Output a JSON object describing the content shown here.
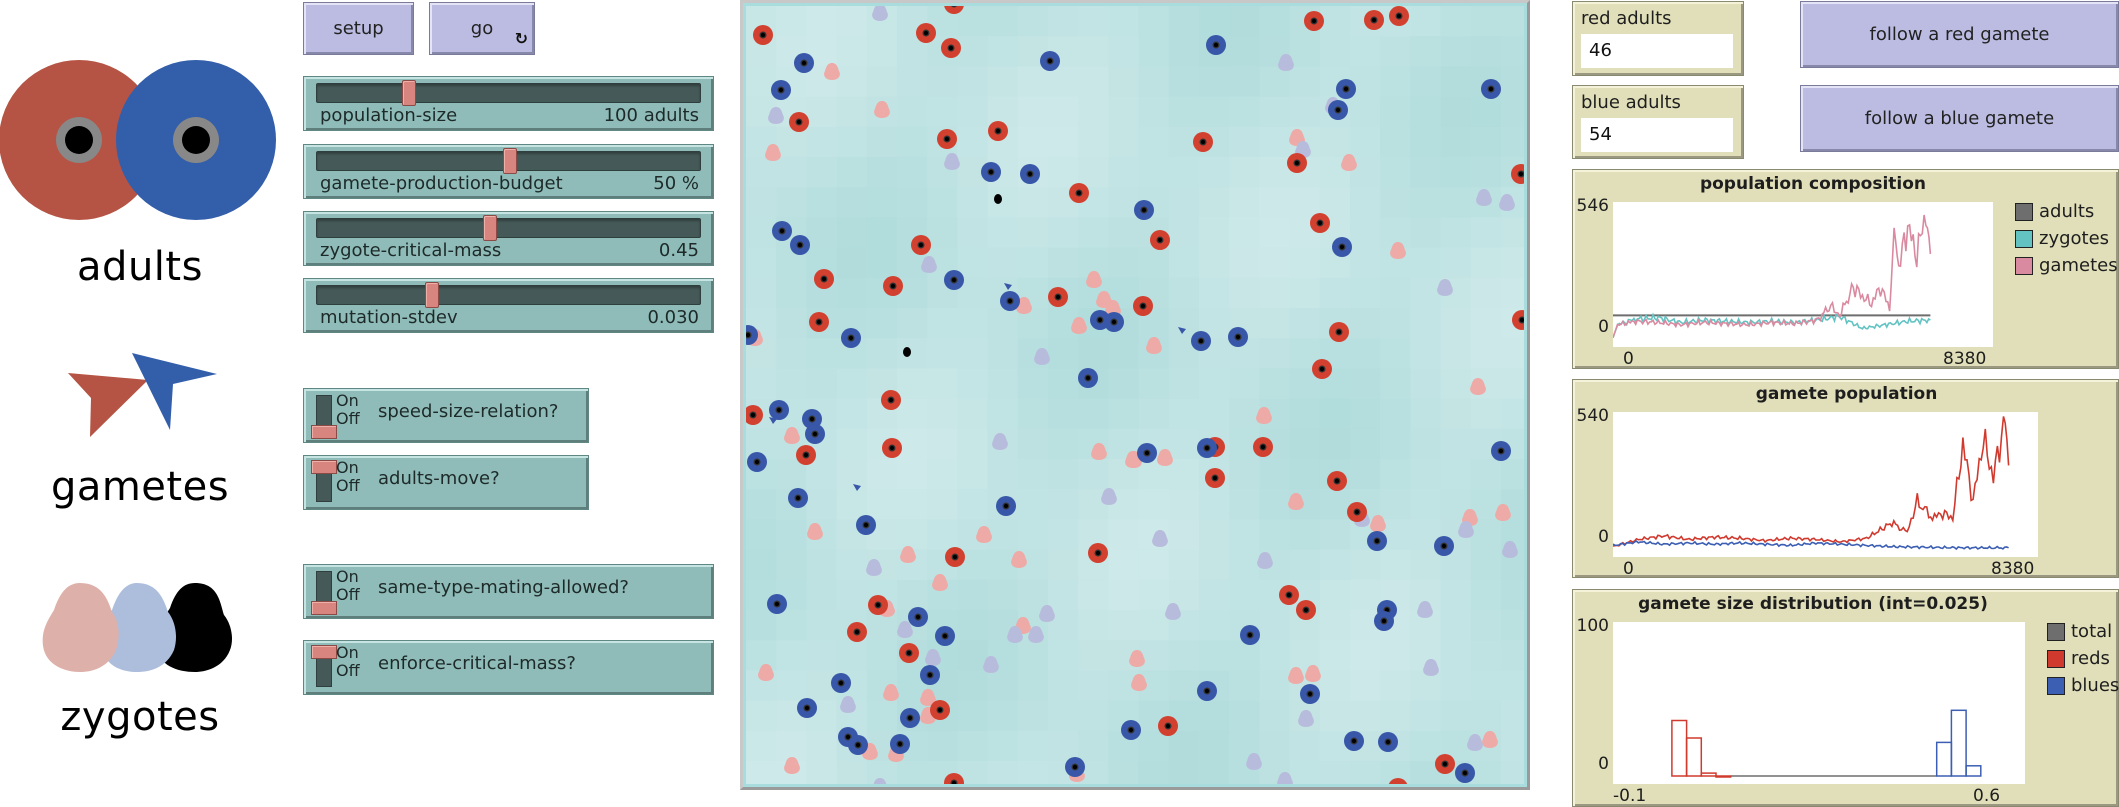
{
  "legend_panel": {
    "adults_label": "adults",
    "gametes_label": "gametes",
    "zygotes_label": "zygotes",
    "colors": {
      "red_adult": "#b55444",
      "blue_adult": "#335eaa",
      "adult_ring": "#888888",
      "red_gamete": "#b55444",
      "blue_gamete": "#335eaa",
      "red_zygote": "#deb0aa",
      "blue_zygote": "#adbddc",
      "black_zygote": "#000000"
    }
  },
  "buttons": {
    "setup_label": "setup",
    "go_label": "go",
    "go_forever_icon": "forever-arrows-icon",
    "follow_red_label": "follow a red gamete",
    "follow_blue_label": "follow a blue gamete"
  },
  "sliders": [
    {
      "name": "population-size",
      "value_text": "100 adults",
      "fraction": 0.24
    },
    {
      "name": "gamete-production-budget",
      "value_text": "50 %",
      "fraction": 0.5
    },
    {
      "name": "zygote-critical-mass",
      "value_text": "0.45",
      "fraction": 0.45
    },
    {
      "name": "mutation-stdev",
      "value_text": "0.030",
      "fraction": 0.3
    }
  ],
  "switches": [
    {
      "name": "speed-size-relation?",
      "on": false
    },
    {
      "name": "adults-move?",
      "on": true
    },
    {
      "name": "same-type-mating-allowed?",
      "on": false
    },
    {
      "name": "enforce-critical-mass?",
      "on": true
    }
  ],
  "switch_text": {
    "on": "On",
    "off": "Off"
  },
  "monitors": {
    "red_adults_label": "red adults",
    "red_adults_value": "46",
    "blue_adults_label": "blue adults",
    "blue_adults_value": "54"
  },
  "world": {
    "background": "#a9dcdc",
    "red_adult_color": "#d2402f",
    "blue_adult_color": "#3857a8",
    "red_zygote_color": "#eeaaa6",
    "blue_zygote_color": "#b8bcdc",
    "fertile_zygote_color": "#000000",
    "red_adult_count": 46,
    "blue_adult_count": 54
  },
  "chart_data": [
    {
      "type": "line",
      "title": "population composition",
      "xlabel": "",
      "ylabel": "",
      "xlim": [
        0,
        8380
      ],
      "ylim": [
        0,
        546
      ],
      "x_tick_labels": [
        "0",
        "8380"
      ],
      "y_tick_labels": [
        "0",
        "546"
      ],
      "legend": "right",
      "series": [
        {
          "name": "adults",
          "color": "#6e6e6e",
          "x": [
            0,
            7000
          ],
          "values": [
            100,
            100
          ]
        },
        {
          "name": "zygotes",
          "color": "#63c3c3",
          "x": [
            0,
            100,
            500,
            1000,
            1500,
            2000,
            2500,
            3000,
            3500,
            4000,
            4500,
            5000,
            5500,
            6000,
            6500,
            7000
          ],
          "values": [
            0,
            60,
            85,
            90,
            70,
            80,
            75,
            70,
            75,
            70,
            80,
            95,
            45,
            60,
            75,
            80
          ]
        },
        {
          "name": "gametes",
          "color": "#d98aa0",
          "x": [
            0,
            100,
            500,
            1000,
            1500,
            2000,
            2500,
            3000,
            3500,
            4000,
            4500,
            4800,
            5000,
            5300,
            5500,
            5700,
            5900,
            6100,
            6200,
            6300,
            6500,
            6700,
            6900,
            7000
          ],
          "values": [
            0,
            60,
            75,
            70,
            60,
            70,
            65,
            60,
            70,
            65,
            80,
            140,
            100,
            220,
            180,
            150,
            220,
            130,
            420,
            300,
            480,
            350,
            546,
            360
          ]
        }
      ]
    },
    {
      "type": "line",
      "title": "gamete population",
      "xlabel": "",
      "ylabel": "",
      "xlim": [
        0,
        8380
      ],
      "ylim": [
        0,
        540
      ],
      "x_tick_labels": [
        "0",
        "8380"
      ],
      "y_tick_labels": [
        "0",
        "540"
      ],
      "legend": "none",
      "series": [
        {
          "name": "reds",
          "color": "#d03a2e",
          "x": [
            0,
            500,
            1000,
            1500,
            2000,
            2500,
            3000,
            3500,
            4000,
            4500,
            5000,
            5500,
            5800,
            6000,
            6300,
            6500,
            6700,
            6900,
            7100,
            7300,
            7500,
            7700,
            7800
          ],
          "values": [
            10,
            40,
            55,
            40,
            50,
            45,
            35,
            45,
            40,
            30,
            45,
            110,
            70,
            200,
            130,
            150,
            130,
            440,
            200,
            460,
            300,
            520,
            350
          ]
        },
        {
          "name": "blues",
          "color": "#3c5fb3",
          "x": [
            0,
            500,
            1000,
            1500,
            2000,
            2500,
            3000,
            3500,
            4000,
            4500,
            5000,
            5500,
            6000,
            6500,
            7000,
            7500,
            7800
          ],
          "values": [
            15,
            30,
            20,
            25,
            20,
            25,
            20,
            15,
            25,
            20,
            15,
            10,
            8,
            6,
            5,
            5,
            5
          ]
        }
      ]
    },
    {
      "type": "bar",
      "title": "gamete size distribution (int=0.025)",
      "xlabel": "",
      "ylabel": "",
      "xlim": [
        -0.1,
        0.6
      ],
      "ylim": [
        0,
        100
      ],
      "x_tick_labels": [
        "-0.1",
        "0.6"
      ],
      "y_tick_labels": [
        "0",
        "100"
      ],
      "bin_width": 0.025,
      "legend": "right",
      "series": [
        {
          "name": "total",
          "color": "#6e6e6e",
          "bins": [],
          "values": []
        },
        {
          "name": "reds",
          "color": "#d03a2e",
          "bins": [
            0.0,
            0.025,
            0.05,
            0.075
          ],
          "values": [
            38,
            26,
            2,
            0
          ]
        },
        {
          "name": "blues",
          "color": "#3c5fb3",
          "bins": [
            0.45,
            0.475,
            0.5
          ],
          "values": [
            23,
            45,
            7
          ]
        }
      ]
    }
  ]
}
